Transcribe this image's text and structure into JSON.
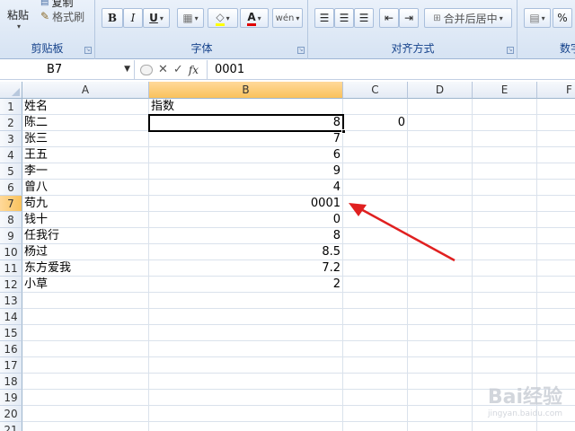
{
  "ribbon": {
    "clipboard": {
      "paste_label": "粘贴",
      "copy_label": "复制",
      "format_painter_label": "格式刷",
      "group_label": "剪贴板"
    },
    "font": {
      "bold": "B",
      "italic": "I",
      "underline": "U",
      "font_color": "A",
      "wen": "wén",
      "group_label": "字体",
      "font_color_value": "#e00000"
    },
    "alignment": {
      "merge_center_label": "合并后居中",
      "group_label": "对齐方式"
    },
    "number": {
      "percent": "%",
      "group_label": "数字"
    }
  },
  "formula_bar": {
    "name_box": "B7",
    "content": "0001",
    "fx": "fx"
  },
  "columns": [
    "A",
    "B",
    "C",
    "D",
    "E",
    "F"
  ],
  "rows": [
    {
      "n": "1",
      "a": "姓名",
      "b": "指数",
      "c": ""
    },
    {
      "n": "2",
      "a": "陈二",
      "b": "8",
      "c": "0"
    },
    {
      "n": "3",
      "a": "张三",
      "b": "7",
      "c": ""
    },
    {
      "n": "4",
      "a": "王五",
      "b": "6",
      "c": ""
    },
    {
      "n": "5",
      "a": "李一",
      "b": "9",
      "c": ""
    },
    {
      "n": "6",
      "a": "曾八",
      "b": "4",
      "c": ""
    },
    {
      "n": "7",
      "a": "苟九",
      "b": "0001",
      "c": ""
    },
    {
      "n": "8",
      "a": "钱十",
      "b": "0",
      "c": ""
    },
    {
      "n": "9",
      "a": "任我行",
      "b": "8",
      "c": ""
    },
    {
      "n": "10",
      "a": "杨过",
      "b": "8.5",
      "c": ""
    },
    {
      "n": "11",
      "a": "东方爱我",
      "b": "7.2",
      "c": ""
    },
    {
      "n": "12",
      "a": "小草",
      "b": "2",
      "c": ""
    },
    {
      "n": "13",
      "a": "",
      "b": "",
      "c": ""
    },
    {
      "n": "14",
      "a": "",
      "b": "",
      "c": ""
    },
    {
      "n": "15",
      "a": "",
      "b": "",
      "c": ""
    },
    {
      "n": "16",
      "a": "",
      "b": "",
      "c": ""
    },
    {
      "n": "17",
      "a": "",
      "b": "",
      "c": ""
    },
    {
      "n": "18",
      "a": "",
      "b": "",
      "c": ""
    },
    {
      "n": "19",
      "a": "",
      "b": "",
      "c": ""
    },
    {
      "n": "20",
      "a": "",
      "b": "",
      "c": ""
    },
    {
      "n": "21",
      "a": "",
      "b": "",
      "c": ""
    }
  ],
  "annotation": {
    "arrow_color": "#e02020"
  },
  "watermark": {
    "text": "Bai经验",
    "sub": "jingyan.baidu.com"
  }
}
